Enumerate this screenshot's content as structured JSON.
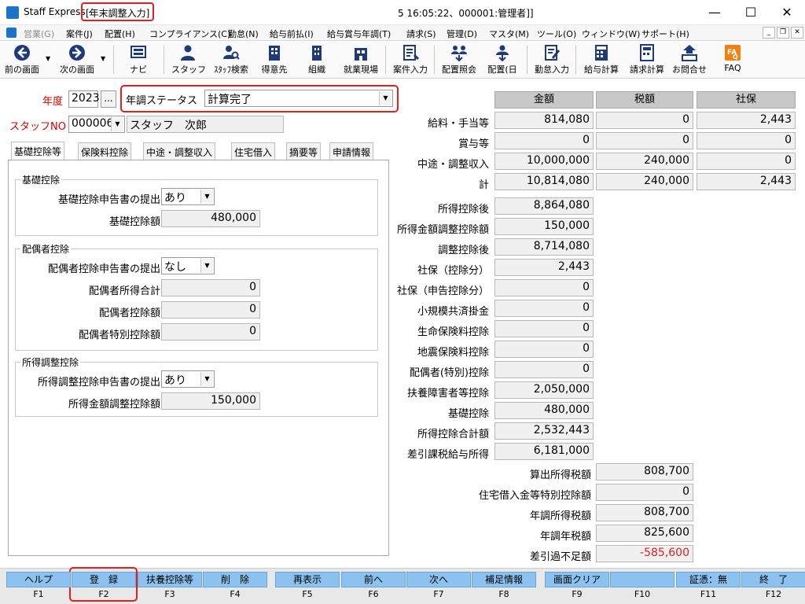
{
  "titlebar": {
    "app_name": "Staff Express -",
    "screen": "[年末調整入力]",
    "status": "5 16:05:22、000001:管理者]]",
    "minimize": "—",
    "maximize": "☐",
    "close": "✕"
  },
  "menu": [
    "営業(G)",
    "案件(J)",
    "配置(H)",
    "コンプライアンス(C)",
    "勤怠(N)",
    "給与前払(I)",
    "給与賞与年調(T)",
    "請求(S)",
    "管理(D)",
    "マスタ(M)",
    "ツール(O)",
    "ウィンドウ(W)",
    "サポート(H)"
  ],
  "toolbar": [
    "前の画面",
    "次の画面",
    "ナビ",
    "スタッフ",
    "ｽﾀｯﾌ検索",
    "得意先",
    "組織",
    "就業現場",
    "案件入力",
    "配置照会",
    "配置(日",
    "勤怠入力",
    "給与計算",
    "請求計算",
    "お問合せ",
    "FAQ"
  ],
  "form": {
    "year_label": "年度",
    "year_value": "2023",
    "year_button": "...",
    "status_label": "年調ステータス",
    "status_value": "計算完了",
    "staff_label": "スタッフNO",
    "staff_no": "000006",
    "staff_name": "スタッフ　次郎"
  },
  "tabs": [
    "基礎控除等",
    "保険料控除",
    "中途・調整収入",
    "住宅借入",
    "摘要等",
    "申請情報"
  ],
  "groups": {
    "basic": {
      "title": "基礎控除",
      "submit_label": "基礎控除申告書の提出",
      "submit_value": "あり",
      "amount_label": "基礎控除額",
      "amount_value": "480,000"
    },
    "spouse": {
      "title": "配偶者控除",
      "submit_label": "配偶者控除申告書の提出",
      "submit_value": "なし",
      "income_label": "配偶者所得合計",
      "income_value": "0",
      "deduction_label": "配偶者控除額",
      "deduction_value": "0",
      "special_label": "配偶者特別控除額",
      "special_value": "0"
    },
    "adjust": {
      "title": "所得調整控除",
      "submit_label": "所得調整控除申告書の提出",
      "submit_value": "あり",
      "amount_label": "所得金額調整控除額",
      "amount_value": "150,000"
    }
  },
  "right": {
    "headers": [
      "金額",
      "税額",
      "社保"
    ],
    "top_rows": [
      {
        "label": "給料・手当等",
        "amount": "814,080",
        "tax": "0",
        "social": "2,443"
      },
      {
        "label": "賞与等",
        "amount": "0",
        "tax": "0",
        "social": "0"
      },
      {
        "label": "中途・調整収入",
        "amount": "10,000,000",
        "tax": "240,000",
        "social": "0"
      },
      {
        "label": "計",
        "amount": "10,814,080",
        "tax": "240,000",
        "social": "2,443"
      }
    ],
    "mid_rows": [
      {
        "label": "所得控除後",
        "value": "8,864,080"
      },
      {
        "label": "所得金額調整控除額",
        "value": "150,000"
      },
      {
        "label": "調整控除後",
        "value": "8,714,080"
      },
      {
        "label": "社保（控除分）",
        "value": "2,443"
      },
      {
        "label": "社保（申告控除分）",
        "value": "0"
      },
      {
        "label": "小規模共済掛金",
        "value": "0"
      },
      {
        "label": "生命保険料控除",
        "value": "0"
      },
      {
        "label": "地震保険料控除",
        "value": "0"
      },
      {
        "label": "配偶者(特別)控除",
        "value": "0"
      },
      {
        "label": "扶養障害者等控除",
        "value": "2,050,000"
      },
      {
        "label": "基礎控除",
        "value": "480,000"
      },
      {
        "label": "所得控除合計額",
        "value": "2,532,443"
      },
      {
        "label": "差引課税給与所得",
        "value": "6,181,000"
      }
    ],
    "tax_rows": [
      {
        "label": "算出所得税額",
        "value": "808,700",
        "negative": false
      },
      {
        "label": "住宅借入金等特別控除額",
        "value": "0",
        "negative": false
      },
      {
        "label": "年調所得税額",
        "value": "808,700",
        "negative": false
      },
      {
        "label": "年調年税額",
        "value": "825,600",
        "negative": false
      },
      {
        "label": "差引過不足額",
        "value": "-585,600",
        "negative": true
      }
    ]
  },
  "fkeys": [
    {
      "label": "ヘルプ",
      "key": "F1"
    },
    {
      "label": "登　録",
      "key": "F2"
    },
    {
      "label": "扶養控除等",
      "key": "F3"
    },
    {
      "label": "削　除",
      "key": "F4"
    },
    {
      "label": "再表示",
      "key": "F5"
    },
    {
      "label": "前へ",
      "key": "F6"
    },
    {
      "label": "次へ",
      "key": "F7"
    },
    {
      "label": "補足情報",
      "key": "F8"
    },
    {
      "label": "画面クリア",
      "key": "F9"
    },
    {
      "label": "",
      "key": "F10"
    },
    {
      "label": "証憑：無",
      "key": "F11"
    },
    {
      "label": "終　了",
      "key": "F12"
    }
  ],
  "colors": {
    "accent_red": "#e02020",
    "fkey_blue": "#8cc2ef",
    "negative": "#e02020"
  }
}
